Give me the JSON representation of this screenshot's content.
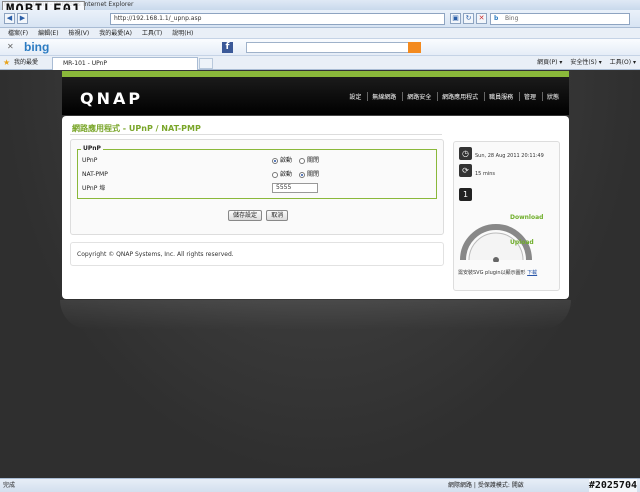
{
  "browser": {
    "title": "MR-101 - UPnP - Windows Internet Explorer",
    "address": "http://192.168.1.1/_upnp.asp",
    "search_placeholder": "Bing",
    "menus": [
      "檔案(F)",
      "編輯(E)",
      "檢視(V)",
      "我的最愛(A)",
      "工具(T)",
      "說明(H)"
    ],
    "bing_logo": "bing",
    "favorites_label": "我的最愛",
    "tab_title": "MR-101 - UPnP",
    "cmd_items": [
      "網頁(P) ▾",
      "安全性(S) ▾",
      "工具(O) ▾"
    ],
    "status_left": "完成",
    "status_right": "網際網路 | 受保護模式: 開啟"
  },
  "watermark": {
    "logo": "MOBILE01",
    "id": "#2025704"
  },
  "header": {
    "logo": "QNAP",
    "nav": [
      "設定",
      "無線網路",
      "網路安全",
      "網路應用程式",
      "職員服務",
      "管理",
      "狀態"
    ]
  },
  "page": {
    "title": "網路應用程式 - UPnP / NAT-PMP",
    "fieldset_legend": "UPnP",
    "rows": [
      {
        "label": "UPnP",
        "options": [
          "啟動",
          "關閉"
        ],
        "selected": 0
      },
      {
        "label": "NAT-PMP",
        "options": [
          "啟動",
          "關閉"
        ],
        "selected": 1
      }
    ],
    "port_label": "UPnP 埠",
    "port_value": "5555",
    "save_label": "儲存設定",
    "cancel_label": "取消",
    "copyright": "Copyright © QNAP Systems, Inc. All rights reserved."
  },
  "sidebar": {
    "datetime": "Sun, 28 Aug 2011 20:11:49",
    "uptime": "15 mins",
    "connection_icon_text": "1",
    "download_label": "Download",
    "upload_label": "Upload",
    "svg_note": "需安裝SVG plugin以顯示圖形",
    "svg_link": "下載"
  }
}
